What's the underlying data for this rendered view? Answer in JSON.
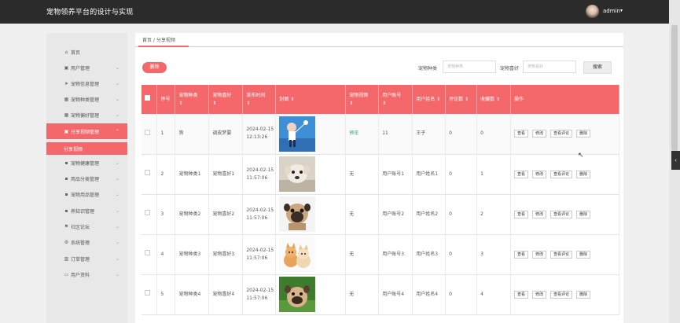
{
  "header": {
    "title": "宠物领养平台的设计与实现",
    "user": "admin",
    "caret": "▾"
  },
  "sidebar": {
    "items": [
      {
        "icon": "⌂",
        "label": "首页",
        "chevron": ""
      },
      {
        "icon": "▣",
        "label": "用户管理",
        "chevron": "⌄"
      },
      {
        "icon": "➤",
        "label": "宠物信息管理",
        "chevron": "⌄"
      },
      {
        "icon": "▦",
        "label": "宠物种类管理",
        "chevron": "⌄"
      },
      {
        "icon": "▦",
        "label": "宠物偏好管理",
        "chevron": "⌄"
      },
      {
        "icon": "▣",
        "label": "分享视频管理",
        "chevron": "⌃"
      },
      {
        "icon": "▪",
        "label": "宠物健康管理",
        "chevron": "⌄"
      },
      {
        "icon": "▪",
        "label": "用品分类管理",
        "chevron": "⌄"
      },
      {
        "icon": "▪",
        "label": "宠物用品管理",
        "chevron": "⌄"
      },
      {
        "icon": "▪",
        "label": "养知识管理",
        "chevron": "⌄"
      },
      {
        "icon": "⚑",
        "label": "社区论坛",
        "chevron": "⌄"
      },
      {
        "icon": "⚙",
        "label": "系统管理",
        "chevron": "⌄"
      },
      {
        "icon": "▥",
        "label": "订单管理",
        "chevron": "⌄"
      },
      {
        "icon": "▭",
        "label": "用户资料",
        "chevron": "⌄"
      }
    ],
    "sub_active": "分享视频"
  },
  "breadcrumb": "首页 / 分享视频",
  "toolbar": {
    "delete": "删除",
    "label_kind": "宠物种类",
    "ph_kind": "宠物种类",
    "label_pref": "宠物喜好",
    "ph_pref": "宠物喜好",
    "search": "搜索"
  },
  "columns": [
    "序号",
    "宠物种类",
    "宠物喜好",
    "发布时间",
    "封面",
    "宠物视频",
    "用户账号",
    "用户姓名",
    "评论数",
    "收藏数",
    "操作"
  ],
  "sort_mark": "⇕",
  "rows": [
    {
      "no": "1",
      "kind": "狗",
      "pref": "调皮梦要",
      "time": "2024-02-15 12:13:26",
      "video": "预览",
      "account": "11",
      "name": "王子",
      "comments": "0",
      "favs": "0"
    },
    {
      "no": "2",
      "kind": "宠物种类1",
      "pref": "宠物喜好1",
      "time": "2024-02-15 11:57:06",
      "video": "无",
      "account": "用户账号1",
      "name": "用户姓名1",
      "comments": "0",
      "favs": "1"
    },
    {
      "no": "3",
      "kind": "宠物种类2",
      "pref": "宠物喜好2",
      "time": "2024-02-15 11:57:06",
      "video": "无",
      "account": "用户账号2",
      "name": "用户姓名2",
      "comments": "0",
      "favs": "2"
    },
    {
      "no": "4",
      "kind": "宠物种类3",
      "pref": "宠物喜好3",
      "time": "2024-02-15 11:57:06",
      "video": "无",
      "account": "用户账号3",
      "name": "用户姓名3",
      "comments": "0",
      "favs": "3"
    },
    {
      "no": "5",
      "kind": "宠物种类4",
      "pref": "宠物喜好4",
      "time": "2024-02-15 11:57:06",
      "video": "无",
      "account": "用户账号4",
      "name": "用户姓名4",
      "comments": "0",
      "favs": "4"
    }
  ],
  "ops": [
    "查看",
    "修改",
    "查看评论",
    "删除"
  ],
  "colors": {
    "accent": "#f4686b",
    "topbar": "#2b2b2b",
    "link": "#3aa17e"
  }
}
